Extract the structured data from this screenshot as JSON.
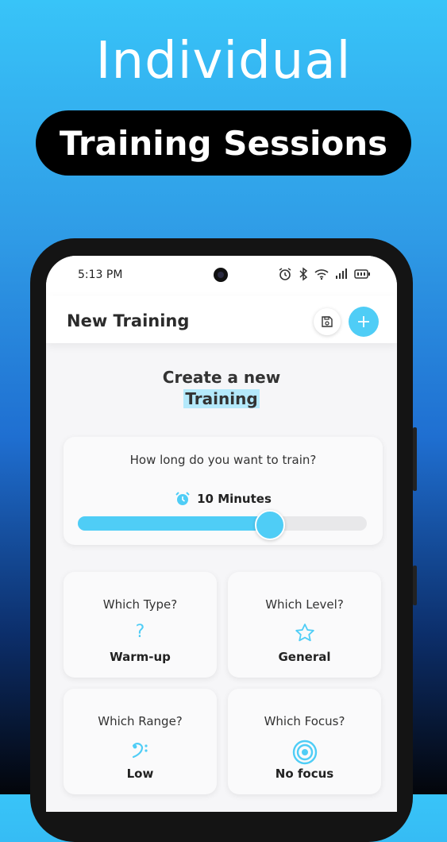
{
  "promo": {
    "headline": "Individual",
    "subheadline": "Training Sessions"
  },
  "statusbar": {
    "time": "5:13 PM"
  },
  "appbar": {
    "title": "New Training"
  },
  "intro": {
    "line1": "Create a new",
    "line2": "Training"
  },
  "duration": {
    "question": "How long do you want to train?",
    "value_label": "10 Minutes",
    "slider_fraction": 0.66
  },
  "options": [
    {
      "question": "Which Type?",
      "value": "Warm-up",
      "icon": "question-mark-icon"
    },
    {
      "question": "Which Level?",
      "value": "General",
      "icon": "star-icon"
    },
    {
      "question": "Which Range?",
      "value": "Low",
      "icon": "bass-clef-icon"
    },
    {
      "question": "Which Focus?",
      "value": "No focus",
      "icon": "target-icon"
    }
  ],
  "colors": {
    "accent": "#4fcdf6",
    "highlight": "#b4e9fb"
  }
}
